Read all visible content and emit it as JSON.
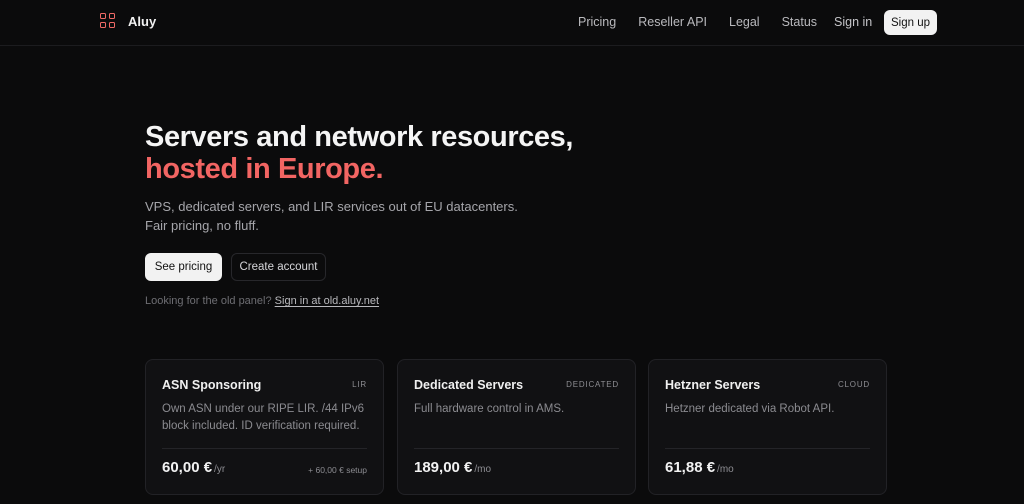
{
  "brand": {
    "name": "Aluy",
    "accent": "#f26563"
  },
  "nav": {
    "links": [
      "Pricing",
      "Reseller API",
      "Legal",
      "Status"
    ],
    "signin": "Sign in",
    "signup": "Sign up"
  },
  "hero": {
    "title_line1": "Servers and network resources,",
    "title_line2": "hosted in Europe.",
    "subtitle": "VPS, dedicated servers, and LIR services out of EU datacenters. Fair pricing, no fluff.",
    "primary_cta": "See pricing",
    "secondary_cta": "Create account",
    "old_panel_text": "Looking for the old panel?",
    "old_panel_link": "Sign in at old.aluy.net"
  },
  "cards": [
    {
      "title": "ASN Sponsoring",
      "tag": "LIR",
      "description": "Own ASN under our RIPE LIR. /44 IPv6 block included. ID verification required.",
      "price": "60,00 €",
      "period": "/yr",
      "setup": "+ 60,00 € setup"
    },
    {
      "title": "Dedicated Servers",
      "tag": "DEDICATED",
      "description": "Full hardware control in AMS.",
      "price": "189,00 €",
      "period": "/mo",
      "setup": ""
    },
    {
      "title": "Hetzner Servers",
      "tag": "CLOUD",
      "description": "Hetzner dedicated via Robot API.",
      "price": "61,88 €",
      "period": "/mo",
      "setup": ""
    }
  ]
}
